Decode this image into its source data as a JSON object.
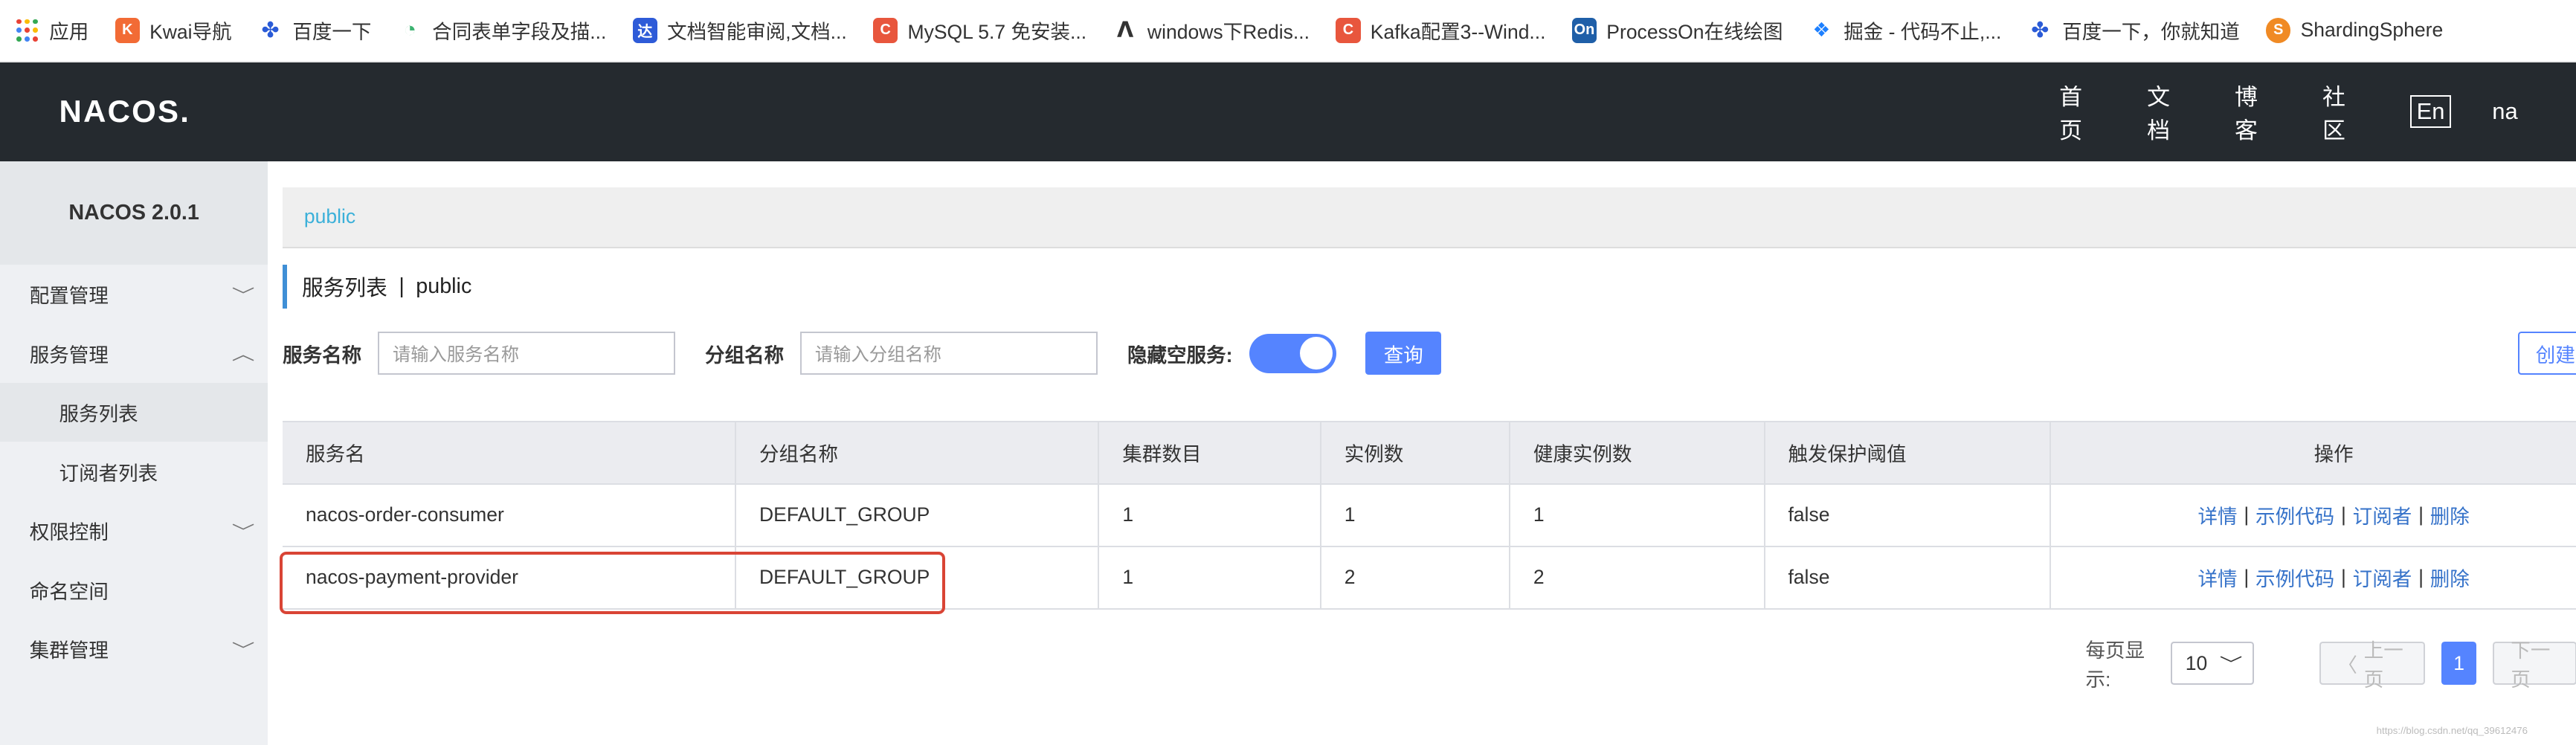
{
  "bookmarks": [
    {
      "label": "应用",
      "icon": "apps-grid-icon",
      "color": "#e94235"
    },
    {
      "label": "Kwai导航",
      "icon": "kwai-icon",
      "color": "#f26b35"
    },
    {
      "label": "百度一下",
      "icon": "baidu-paw-icon",
      "color": "#2a5bd7"
    },
    {
      "label": "合同表单字段及描...",
      "icon": "chart-icon",
      "color": "#3cb371"
    },
    {
      "label": "文档智能审阅,文档...",
      "icon": "da-icon",
      "color": "#2e5bd8"
    },
    {
      "label": "MySQL 5.7 免安装...",
      "icon": "csdn-c-icon",
      "color": "#e8563d"
    },
    {
      "label": "windows下Redis...",
      "icon": "feather-icon",
      "color": "#333333"
    },
    {
      "label": "Kafka配置3--Wind...",
      "icon": "csdn-c-icon",
      "color": "#e8563d"
    },
    {
      "label": "ProcessOn在线绘图",
      "icon": "processon-icon",
      "color": "#1f5fa8"
    },
    {
      "label": "掘金 - 代码不止,...",
      "icon": "juejin-icon",
      "color": "#1e80ff"
    },
    {
      "label": "百度一下，你就知道",
      "icon": "baidu-paw-icon",
      "color": "#2a5bd7"
    },
    {
      "label": "ShardingSphere",
      "icon": "shardingsphere-icon",
      "color": "#f08a24"
    }
  ],
  "header": {
    "logo": "NACOS.",
    "nav": [
      "首页",
      "文档",
      "博客",
      "社区"
    ],
    "lang": "En",
    "user": "na"
  },
  "sidebar": {
    "version": "NACOS 2.0.1",
    "items": [
      {
        "label": "配置管理",
        "chevron": "﹀"
      },
      {
        "label": "服务管理",
        "chevron": "︿"
      },
      {
        "label": "服务列表"
      },
      {
        "label": "订阅者列表"
      },
      {
        "label": "权限控制",
        "chevron": "﹀"
      },
      {
        "label": "命名空间"
      },
      {
        "label": "集群管理",
        "chevron": "﹀"
      }
    ]
  },
  "main": {
    "namespace_crumb": "public",
    "title": "服务列表",
    "title_sep": "|",
    "title_ns": "public",
    "filters": {
      "service_label": "服务名称",
      "service_placeholder": "请输入服务名称",
      "group_label": "分组名称",
      "group_placeholder": "请输入分组名称",
      "hide_empty_label": "隐藏空服务:",
      "query_button": "查询",
      "create_button": "创建"
    },
    "table": {
      "headers": [
        "服务名",
        "分组名称",
        "集群数目",
        "实例数",
        "健康实例数",
        "触发保护阈值",
        "操作"
      ],
      "rows": [
        [
          "nacos-order-consumer",
          "DEFAULT_GROUP",
          "1",
          "1",
          "1",
          "false"
        ],
        [
          "nacos-payment-provider",
          "DEFAULT_GROUP",
          "1",
          "2",
          "2",
          "false"
        ]
      ],
      "ops": [
        "详情",
        "示例代码",
        "订阅者",
        "删除"
      ],
      "ops_sep": "|"
    },
    "pager": {
      "page_size_label": "每页显示:",
      "page_size": "10",
      "prev": "上一页",
      "current": "1",
      "next": "下一页"
    },
    "watermark": "https://blog.csdn.net/qq_39612476"
  }
}
